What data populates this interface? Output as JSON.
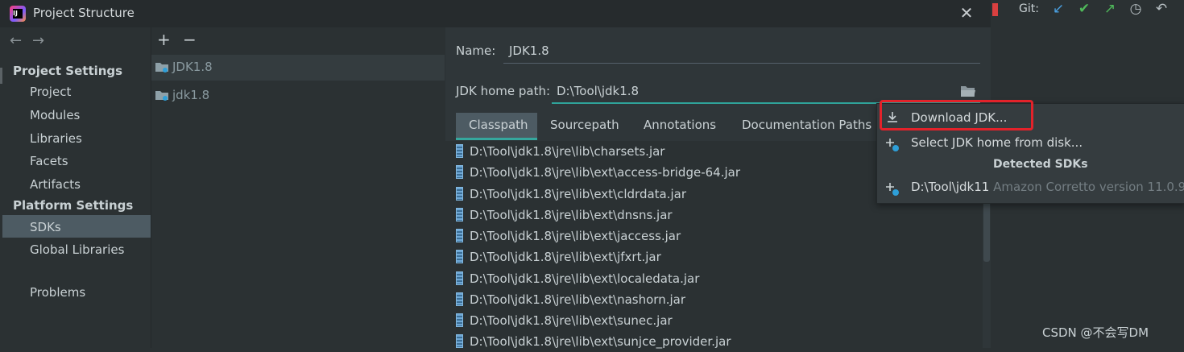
{
  "window": {
    "title": "Project Structure",
    "close_icon": "close-icon"
  },
  "ide_toolbar": {
    "git_label": "Git:",
    "icons": [
      "update-project-icon",
      "commit-check-icon",
      "push-arrow-icon",
      "history-clock-icon",
      "rollback-icon"
    ]
  },
  "nav": {
    "project_settings": "Project Settings",
    "project_items": [
      "Project",
      "Modules",
      "Libraries",
      "Facets",
      "Artifacts"
    ],
    "platform_settings": "Platform Settings",
    "platform_items": [
      "SDKs",
      "Global Libraries"
    ],
    "problems": "Problems",
    "selected": "SDKs"
  },
  "sdk_list": {
    "add": "+",
    "remove": "−",
    "items": [
      "JDK1.8",
      "jdk1.8"
    ]
  },
  "detail": {
    "name_label": "Name:",
    "name_value": "JDK1.8",
    "home_label": "JDK home path:",
    "home_value": "D:\\Tool\\jdk1.8",
    "tabs": [
      "Classpath",
      "Sourcepath",
      "Annotations",
      "Documentation Paths"
    ],
    "active_tab": "Classpath",
    "classpath": [
      "D:\\Tool\\jdk1.8\\jre\\lib\\charsets.jar",
      "D:\\Tool\\jdk1.8\\jre\\lib\\ext\\access-bridge-64.jar",
      "D:\\Tool\\jdk1.8\\jre\\lib\\ext\\cldrdata.jar",
      "D:\\Tool\\jdk1.8\\jre\\lib\\ext\\dnsns.jar",
      "D:\\Tool\\jdk1.8\\jre\\lib\\ext\\jaccess.jar",
      "D:\\Tool\\jdk1.8\\jre\\lib\\ext\\jfxrt.jar",
      "D:\\Tool\\jdk1.8\\jre\\lib\\ext\\localedata.jar",
      "D:\\Tool\\jdk1.8\\jre\\lib\\ext\\nashorn.jar",
      "D:\\Tool\\jdk1.8\\jre\\lib\\ext\\sunec.jar",
      "D:\\Tool\\jdk1.8\\jre\\lib\\ext\\sunjce_provider.jar"
    ]
  },
  "popup": {
    "download": "Download JDK...",
    "select_disk": "Select JDK home from disk...",
    "detected_heading": "Detected SDKs",
    "detected_path": "D:\\Tool\\jdk11",
    "detected_desc": "Amazon Corretto version 11.0.9"
  },
  "watermark": "CSDN @不会写DM",
  "colors": {
    "accent": "#35a89e",
    "highlight_box": "#e3222a",
    "selection": "#4d5b63"
  }
}
